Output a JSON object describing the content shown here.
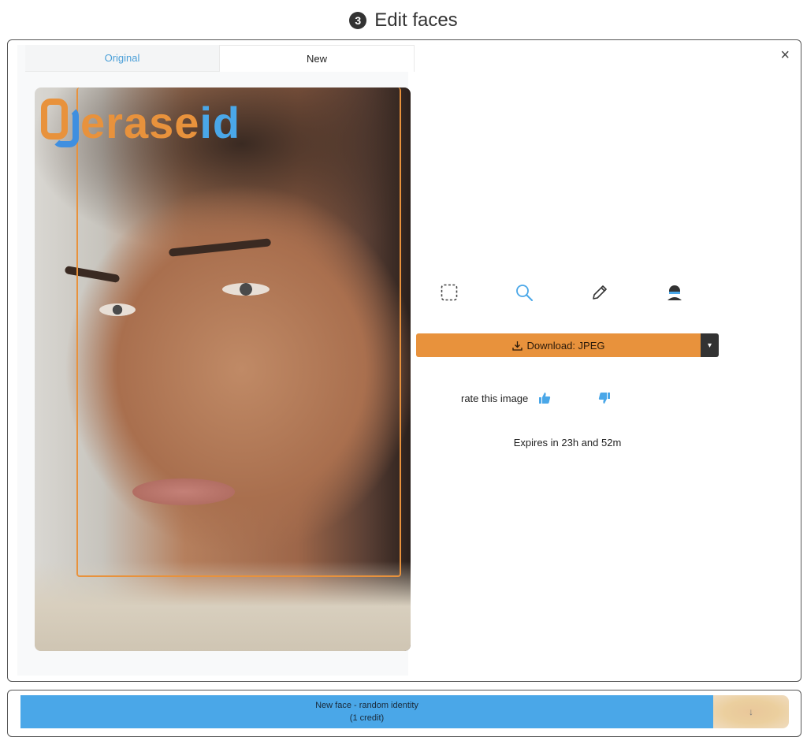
{
  "header": {
    "step_number": "3",
    "title": "Edit faces"
  },
  "editor": {
    "close_glyph": "×",
    "tabs": [
      {
        "label": "Original",
        "active": false
      },
      {
        "label": "New",
        "active": true
      }
    ],
    "logo": {
      "part_a": "erase",
      "part_b": "id"
    },
    "tools": [
      {
        "icon": "select-region-icon"
      },
      {
        "icon": "zoom-icon"
      },
      {
        "icon": "pencil-icon"
      },
      {
        "icon": "person-icon"
      }
    ],
    "download": {
      "label": "Download: JPEG",
      "caret": "▾"
    },
    "rating": {
      "label": "rate this image"
    },
    "expires": "Expires in 23h and 52m"
  },
  "actions": {
    "new_face": {
      "line1": "New face - random identity",
      "line2": "(1 credit)"
    },
    "side_glyph": "↓"
  },
  "colors": {
    "accent_orange": "#e8923c",
    "accent_blue": "#4aa7e8",
    "dark": "#333333"
  }
}
